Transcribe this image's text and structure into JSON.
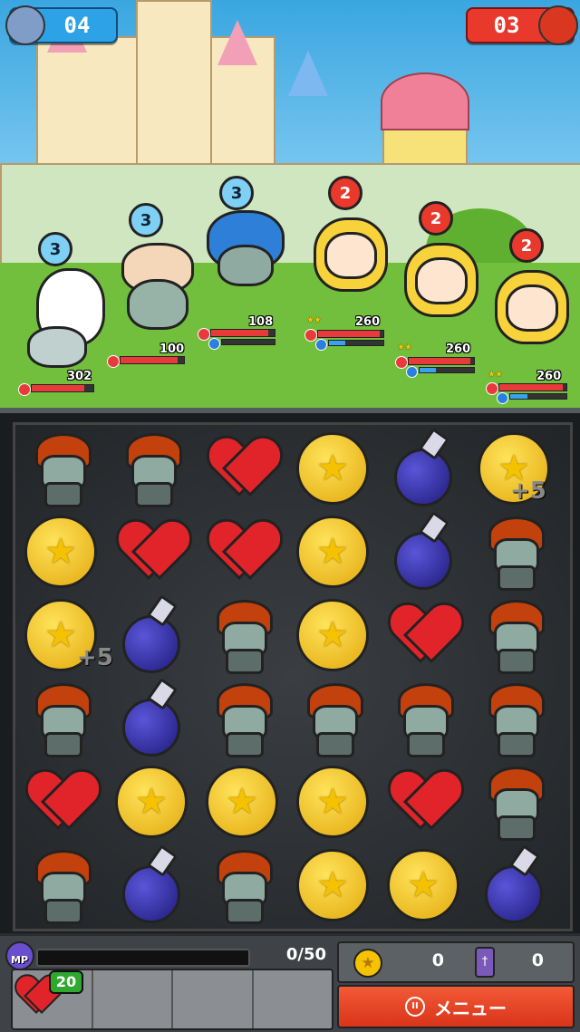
{
  "score": {
    "player": "04",
    "enemy": "03"
  },
  "allies": [
    {
      "name": "wrestler-zombie",
      "turns": "3",
      "hp": "302",
      "hp_fill": 0.85
    },
    {
      "name": "beanie-zombie",
      "turns": "3",
      "hp": "100",
      "hp_fill": 0.9
    },
    {
      "name": "bluehair-zombie",
      "turns": "3",
      "hp": "108",
      "hp_fill": 0.9,
      "mp_fill": 0.0
    }
  ],
  "enemies": [
    {
      "name": "pink-bow-girl",
      "turns": "2",
      "hp": "260",
      "rank": "★★",
      "hp_fill": 0.95,
      "mp_fill": 0.3
    },
    {
      "name": "pink-bow-girl",
      "turns": "2",
      "hp": "260",
      "rank": "★★",
      "hp_fill": 0.95,
      "mp_fill": 0.3
    },
    {
      "name": "pink-bow-girl",
      "turns": "2",
      "hp": "260",
      "rank": "★★",
      "hp_fill": 0.95,
      "mp_fill": 0.3
    }
  ],
  "board": [
    [
      "zombie",
      "zombie",
      "heart",
      "coin",
      "potion",
      "coin"
    ],
    [
      "coin",
      "heart",
      "heart",
      "coin",
      "potion",
      "zombie"
    ],
    [
      "coin",
      "potion",
      "zombie",
      "coin",
      "heart",
      "zombie"
    ],
    [
      "zombie",
      "potion",
      "zombie",
      "zombie",
      "zombie",
      "zombie"
    ],
    [
      "heart",
      "coin",
      "coin",
      "coin",
      "heart",
      "zombie"
    ],
    [
      "zombie",
      "potion",
      "zombie",
      "coin",
      "coin",
      "potion"
    ]
  ],
  "bonuses": {
    "a": "+5",
    "b": "+5"
  },
  "hud": {
    "mp_label": "MP",
    "mp_value": "0/50",
    "mp_fill": 0.0,
    "hp_badge": "20",
    "coins": "0",
    "coffins": "0",
    "menu_label": "メニュー"
  }
}
